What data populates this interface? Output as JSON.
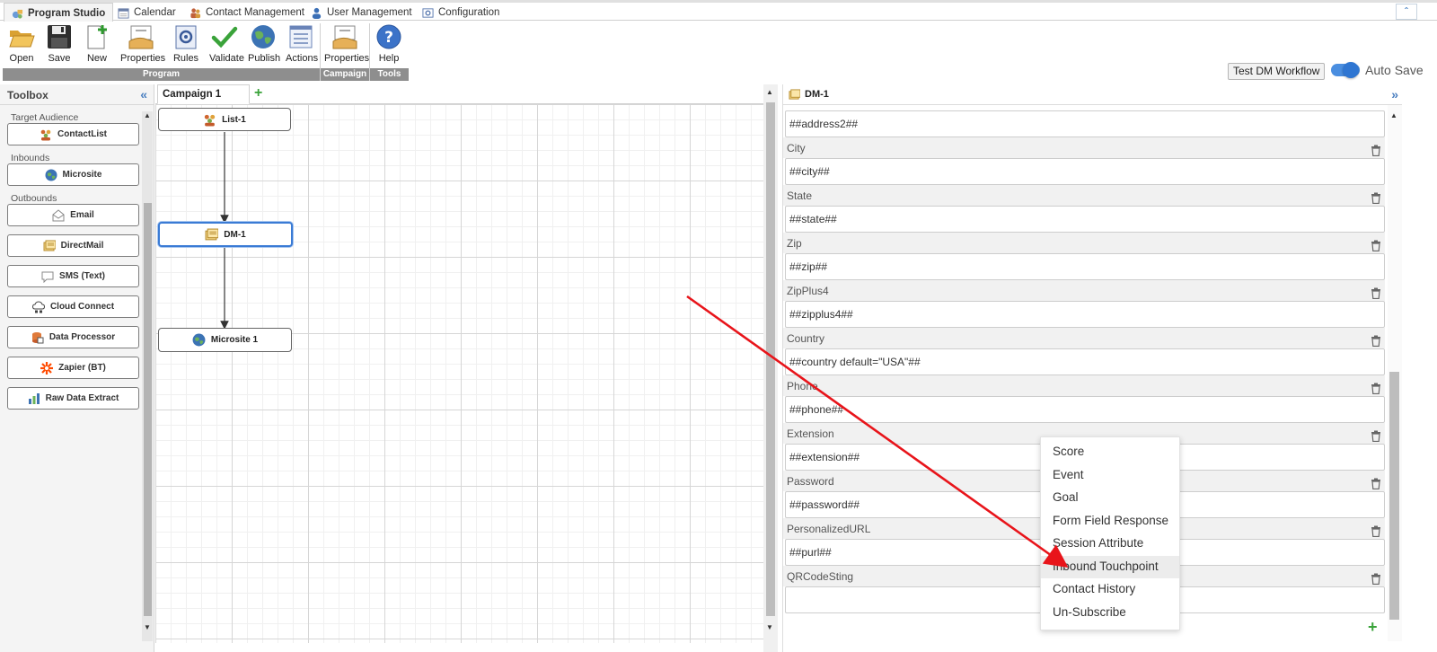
{
  "tabs": [
    {
      "label": "Program Studio",
      "icon": "program-studio-icon",
      "active": true
    },
    {
      "label": "Calendar",
      "icon": "calendar-icon"
    },
    {
      "label": "Contact Management",
      "icon": "contacts-icon"
    },
    {
      "label": "User Management",
      "icon": "user-icon"
    },
    {
      "label": "Configuration",
      "icon": "configuration-icon"
    }
  ],
  "ribbon": {
    "buttons": [
      {
        "label": "Open",
        "icon": "folder-open-icon"
      },
      {
        "label": "Save",
        "icon": "floppy-disk-icon"
      },
      {
        "label": "New",
        "icon": "new-document-icon"
      },
      {
        "label": "Properties",
        "icon": "properties-hand-icon"
      },
      {
        "label": "Rules",
        "icon": "rules-icon"
      },
      {
        "label": "Validate",
        "icon": "checkmark-icon"
      },
      {
        "label": "Publish",
        "icon": "globe-icon"
      },
      {
        "label": "Actions",
        "icon": "actions-list-icon"
      },
      {
        "label": "Properties",
        "icon": "properties-hand-icon"
      },
      {
        "label": "Help",
        "icon": "help-icon"
      }
    ],
    "groups": [
      "Program",
      "Campaign",
      "Tools"
    ],
    "test_button": "Test DM Workflow",
    "autosave_label": "Auto Save",
    "autosave_on": true
  },
  "toolbox": {
    "title": "Toolbox",
    "categories": [
      "Target Audience",
      "Inbounds",
      "Outbounds"
    ],
    "items": [
      {
        "label": "ContactList",
        "icon": "contact-list-icon"
      },
      {
        "label": "Microsite",
        "icon": "globe-icon"
      },
      {
        "label": "Email",
        "icon": "email-icon"
      },
      {
        "label": "DirectMail",
        "icon": "direct-mail-icon"
      },
      {
        "label": "SMS (Text)",
        "icon": "sms-bubble-icon"
      },
      {
        "label": "Cloud Connect",
        "icon": "cloud-connect-icon"
      },
      {
        "label": "Data Processor",
        "icon": "data-processor-icon"
      },
      {
        "label": "Zapier (BT)",
        "icon": "zapier-icon"
      },
      {
        "label": "Raw Data Extract",
        "icon": "raw-data-extract-icon"
      }
    ]
  },
  "canvas": {
    "tab_label": "Campaign 1",
    "nodes": [
      {
        "label": "List-1",
        "icon": "contact-list-icon"
      },
      {
        "label": "DM-1",
        "icon": "direct-mail-icon",
        "selected": true
      },
      {
        "label": "Microsite 1",
        "icon": "globe-icon"
      }
    ]
  },
  "properties": {
    "title": "DM-1",
    "top_value": "##address2##",
    "fields": [
      {
        "label": "City",
        "value": "##city##"
      },
      {
        "label": "State",
        "value": "##state##"
      },
      {
        "label": "Zip",
        "value": "##zip##"
      },
      {
        "label": "ZipPlus4",
        "value": "##zipplus4##"
      },
      {
        "label": "Country",
        "value": "##country default=\"USA\"##"
      },
      {
        "label": "Phone",
        "value": "##phone##"
      },
      {
        "label": "Extension",
        "value": "##extension##"
      },
      {
        "label": "Password",
        "value": "##password##"
      },
      {
        "label": "PersonalizedURL",
        "value": "##purl##"
      },
      {
        "label": "QRCodeSting",
        "value": ""
      }
    ]
  },
  "context_menu": {
    "items": [
      "Score",
      "Event",
      "Goal",
      "Form Field Response",
      "Session Attribute",
      "Inbound Touchpoint",
      "Contact History",
      "Un-Subscribe"
    ],
    "highlighted": "Inbound Touchpoint"
  },
  "colors": {
    "accent": "#3a7bd5",
    "ribbon_group": "#8e8e8e",
    "annotation_arrow": "#e8141a",
    "add_green": "#3aa33a"
  }
}
